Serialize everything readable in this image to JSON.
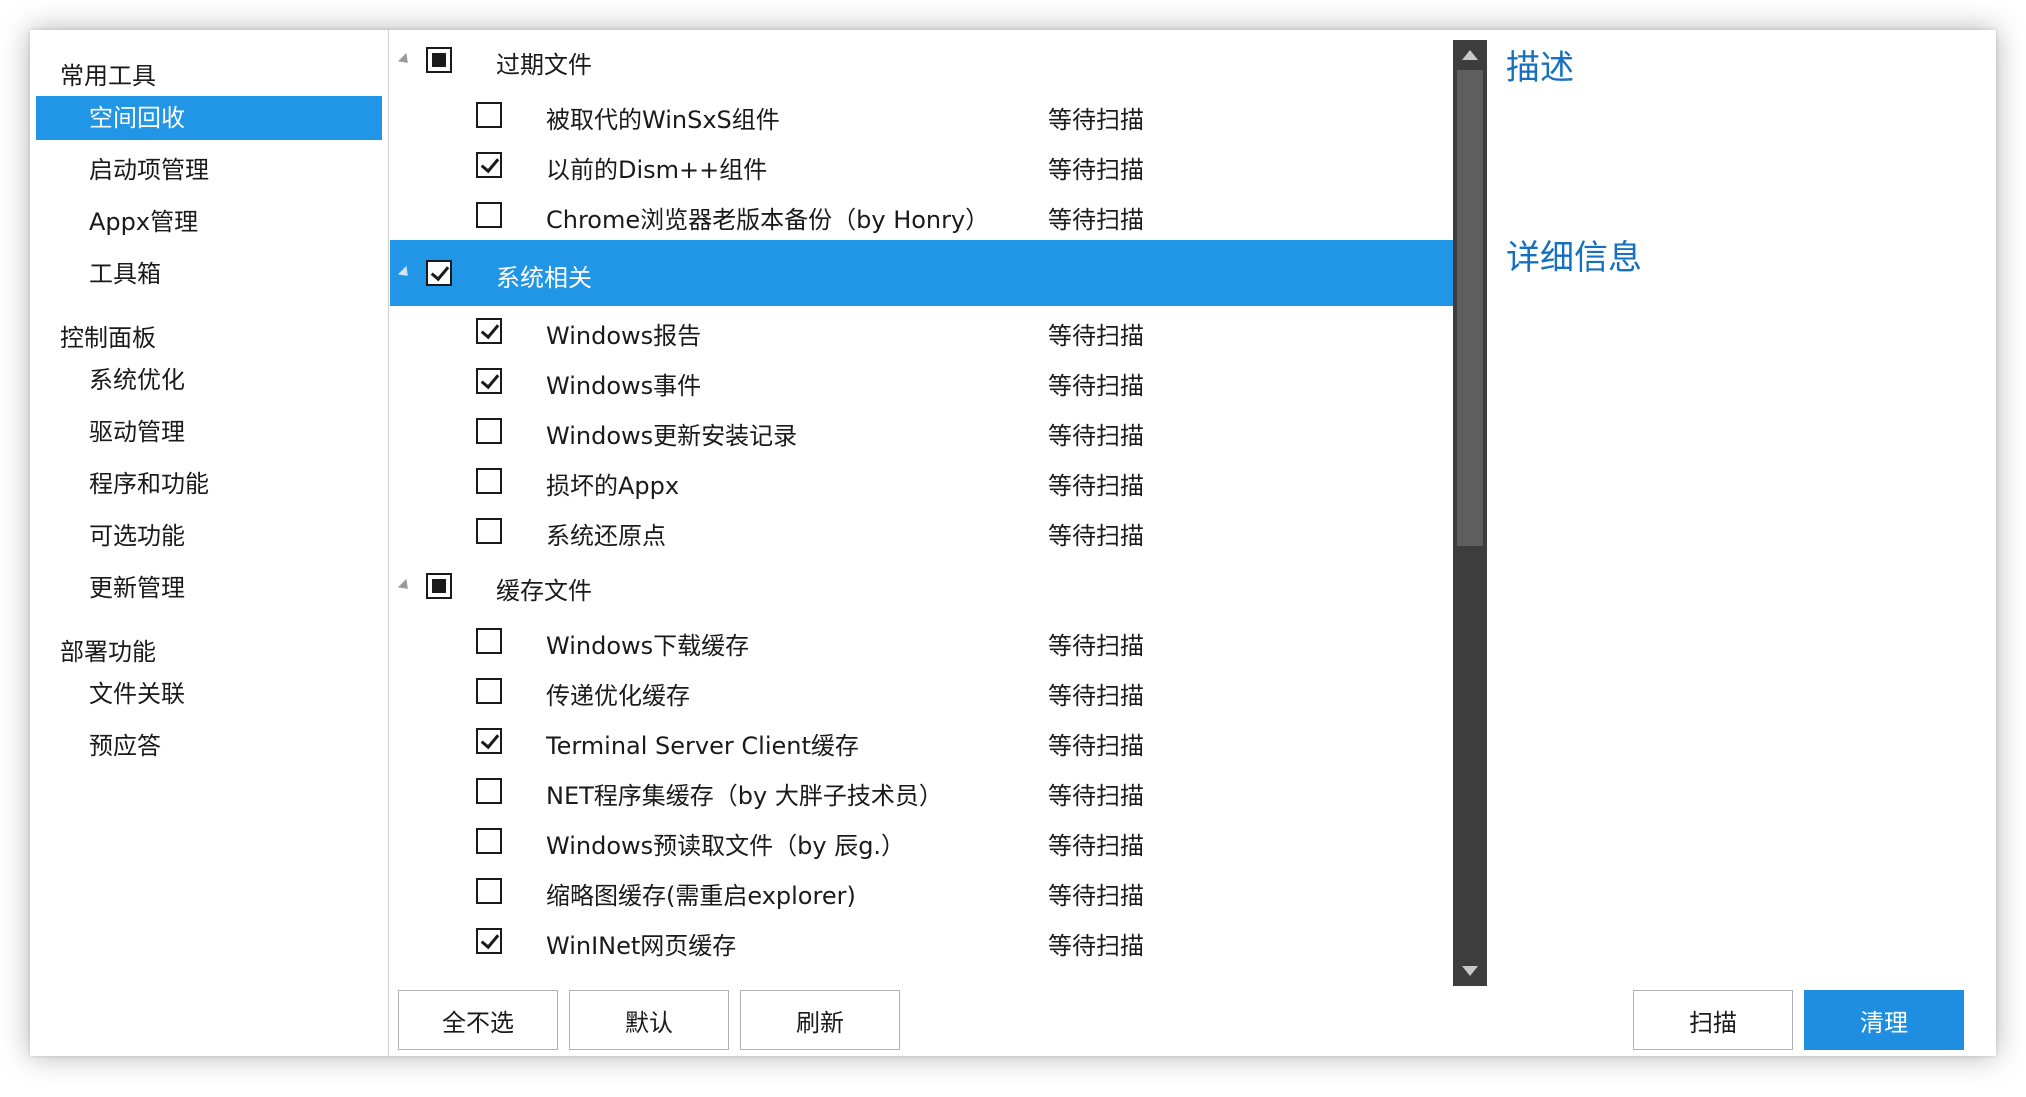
{
  "nav": {
    "groups": [
      {
        "label": "常用工具",
        "items": [
          "空间回收",
          "启动项管理",
          "Appx管理",
          "工具箱"
        ]
      },
      {
        "label": "控制面板",
        "items": [
          "系统优化",
          "驱动管理",
          "程序和功能",
          "可选功能",
          "更新管理"
        ]
      },
      {
        "label": "部署功能",
        "items": [
          "文件关联",
          "预应答"
        ]
      }
    ],
    "selected": "空间回收"
  },
  "list": {
    "categories": [
      {
        "label": "过期文件",
        "state": "partial",
        "items": [
          {
            "label": "被取代的WinSxS组件",
            "checked": false,
            "status": "等待扫描"
          },
          {
            "label": "以前的Dism++组件",
            "checked": true,
            "status": "等待扫描"
          },
          {
            "label": "Chrome浏览器老版本备份（by Honry）",
            "checked": false,
            "status": "等待扫描"
          }
        ]
      },
      {
        "label": "系统相关",
        "state": "checked",
        "selected": true,
        "items": [
          {
            "label": "Windows报告",
            "checked": true,
            "status": "等待扫描"
          },
          {
            "label": "Windows事件",
            "checked": true,
            "status": "等待扫描"
          },
          {
            "label": "Windows更新安装记录",
            "checked": false,
            "status": "等待扫描"
          },
          {
            "label": "损坏的Appx",
            "checked": false,
            "status": "等待扫描"
          },
          {
            "label": "系统还原点",
            "checked": false,
            "status": "等待扫描"
          }
        ]
      },
      {
        "label": "缓存文件",
        "state": "partial",
        "items": [
          {
            "label": "Windows下载缓存",
            "checked": false,
            "status": "等待扫描"
          },
          {
            "label": "传递优化缓存",
            "checked": false,
            "status": "等待扫描"
          },
          {
            "label": "Terminal Server Client缓存",
            "checked": true,
            "status": "等待扫描"
          },
          {
            "label": "NET程序集缓存（by 大胖子技术员）",
            "checked": false,
            "status": "等待扫描"
          },
          {
            "label": "Windows预读取文件（by 辰g.）",
            "checked": false,
            "status": "等待扫描"
          },
          {
            "label": "缩略图缓存(需重启explorer)",
            "checked": false,
            "status": "等待扫描"
          },
          {
            "label": "WinINet网页缓存",
            "checked": true,
            "status": "等待扫描"
          }
        ]
      }
    ]
  },
  "detail": {
    "description_title": "描述",
    "info_title": "详细信息"
  },
  "buttons": {
    "select_none": "全不选",
    "default": "默认",
    "refresh": "刷新",
    "scan": "扫描",
    "clean": "清理"
  },
  "colors": {
    "accent": "#2196e6",
    "primary_button": "#1f8ee0",
    "heading": "#1570c0",
    "scrollbar": "#3d3d3d"
  }
}
